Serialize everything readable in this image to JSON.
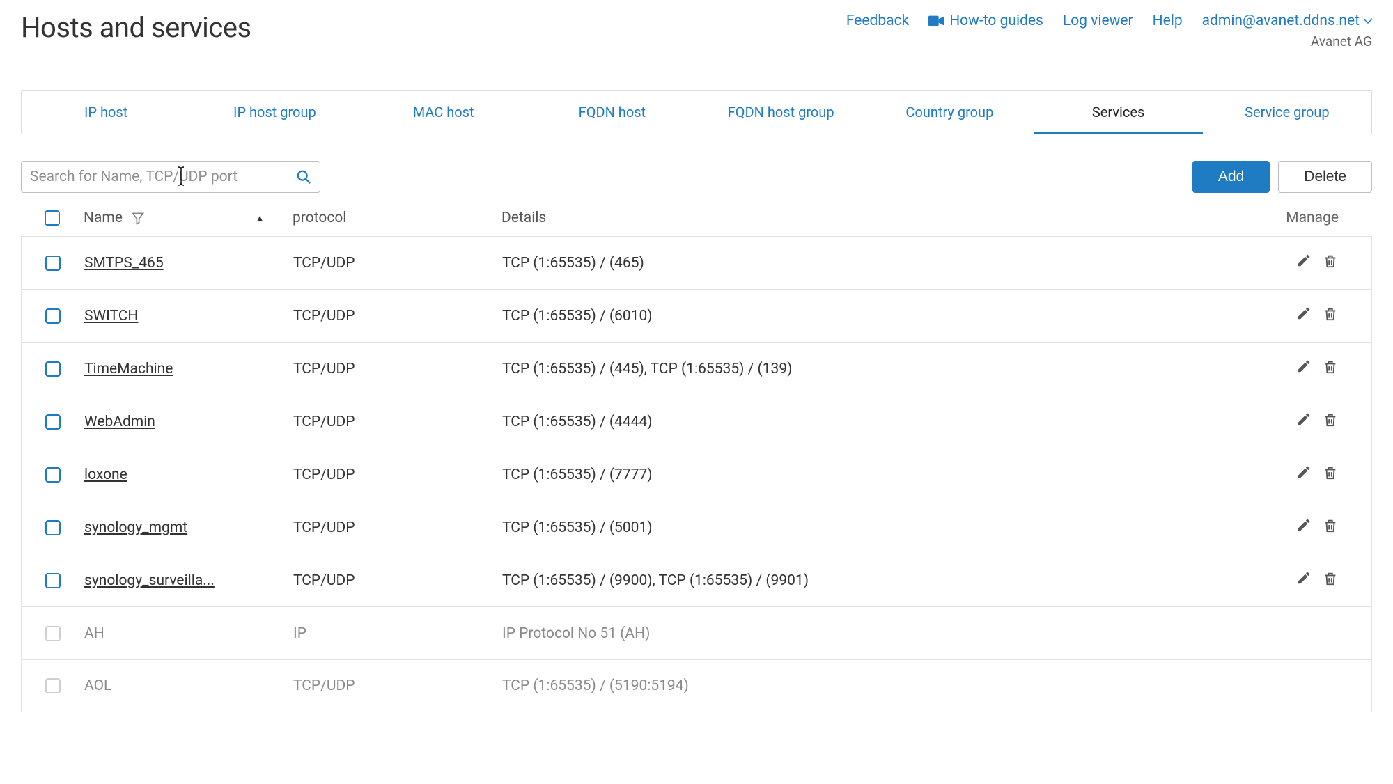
{
  "header": {
    "title": "Hosts and services",
    "links": {
      "feedback": "Feedback",
      "howto": "How-to guides",
      "logviewer": "Log viewer",
      "help": "Help",
      "user": "admin@avanet.ddns.net"
    },
    "org": "Avanet AG"
  },
  "tabs": [
    {
      "label": "IP host",
      "active": false
    },
    {
      "label": "IP host group",
      "active": false
    },
    {
      "label": "MAC host",
      "active": false
    },
    {
      "label": "FQDN host",
      "active": false
    },
    {
      "label": "FQDN host group",
      "active": false
    },
    {
      "label": "Country group",
      "active": false
    },
    {
      "label": "Services",
      "active": true
    },
    {
      "label": "Service group",
      "active": false
    }
  ],
  "toolbar": {
    "search_placeholder": "Search for Name, TCP/UDP port",
    "add_label": "Add",
    "delete_label": "Delete"
  },
  "columns": {
    "name": "Name",
    "protocol": "protocol",
    "details": "Details",
    "manage": "Manage"
  },
  "rows": [
    {
      "name": "SMTPS_465",
      "protocol": "TCP/UDP",
      "details": "TCP (1:65535) / (465)",
      "editable": true
    },
    {
      "name": "SWITCH",
      "protocol": "TCP/UDP",
      "details": "TCP (1:65535) / (6010)",
      "editable": true
    },
    {
      "name": "TimeMachine",
      "protocol": "TCP/UDP",
      "details": "TCP (1:65535) / (445), TCP (1:65535) / (139)",
      "editable": true
    },
    {
      "name": "WebAdmin",
      "protocol": "TCP/UDP",
      "details": "TCP (1:65535) / (4444)",
      "editable": true
    },
    {
      "name": "loxone",
      "protocol": "TCP/UDP",
      "details": "TCP (1:65535) / (7777)",
      "editable": true
    },
    {
      "name": "synology_mgmt",
      "protocol": "TCP/UDP",
      "details": "TCP (1:65535) / (5001)",
      "editable": true
    },
    {
      "name": "synology_surveilla...",
      "protocol": "TCP/UDP",
      "details": "TCP (1:65535) / (9900), TCP (1:65535) / (9901)",
      "editable": true
    },
    {
      "name": "AH",
      "protocol": "IP",
      "details": "IP Protocol No 51 (AH)",
      "editable": false
    },
    {
      "name": "AOL",
      "protocol": "TCP/UDP",
      "details": "TCP (1:65535) / (5190:5194)",
      "editable": false
    }
  ]
}
